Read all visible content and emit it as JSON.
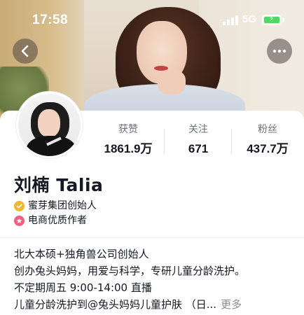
{
  "status_bar": {
    "time": "17:58",
    "network": "5G"
  },
  "header": {
    "back_icon": "chevron-left-icon",
    "more_icon": "more-horizontal-icon"
  },
  "profile": {
    "name": "刘楠 Talia",
    "stats": [
      {
        "label": "获赞",
        "value": "1861.9万"
      },
      {
        "label": "关注",
        "value": "671"
      },
      {
        "label": "粉丝",
        "value": "437.7万"
      }
    ],
    "badges": [
      {
        "icon": "verified-check-icon",
        "text": "蜜芽集团创始人",
        "color": "#f1b533"
      },
      {
        "icon": "star-badge-icon",
        "text": "电商优质作者",
        "color": "#f0607f"
      }
    ],
    "bio": [
      "北大本硕+独角兽公司创始人",
      "创办兔头妈妈，用爱与科学，专研儿童分龄洗护。",
      "不定期周五 9:00-14:00 直播",
      "儿童分龄洗护到@兔头妈妈儿童护肤 （日..."
    ],
    "more_label": "更多"
  },
  "colors": {
    "battery": "#4cd964",
    "text_primary": "#161823",
    "text_secondary": "#6f7079"
  }
}
